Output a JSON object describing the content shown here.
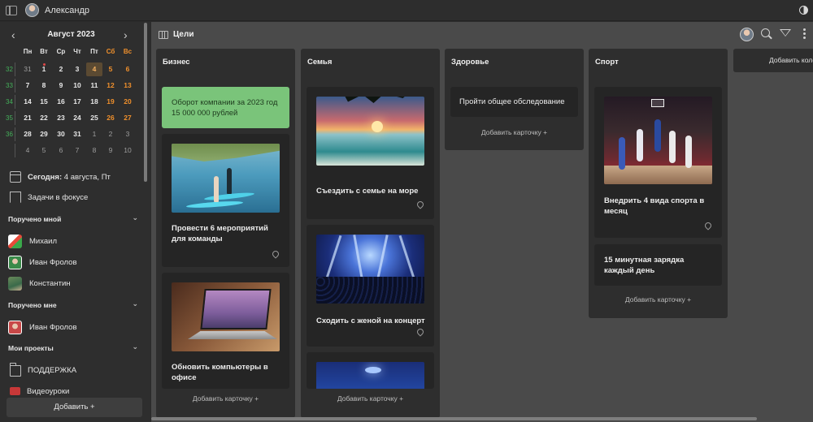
{
  "topbar": {
    "user_name": "Александр"
  },
  "calendar": {
    "month_label": "Август 2023",
    "weekdays": [
      "Пн",
      "Вт",
      "Ср",
      "Чт",
      "Пт",
      "Сб",
      "Вс"
    ],
    "weeks": [
      {
        "num": "32",
        "days": [
          "31",
          "1",
          "2",
          "3",
          "4",
          "5",
          "6"
        ]
      },
      {
        "num": "33",
        "days": [
          "7",
          "8",
          "9",
          "10",
          "11",
          "12",
          "13"
        ]
      },
      {
        "num": "34",
        "days": [
          "14",
          "15",
          "16",
          "17",
          "18",
          "19",
          "20"
        ]
      },
      {
        "num": "35",
        "days": [
          "21",
          "22",
          "23",
          "24",
          "25",
          "26",
          "27"
        ]
      },
      {
        "num": "36",
        "days": [
          "28",
          "29",
          "30",
          "31",
          "1",
          "2",
          "3"
        ]
      },
      {
        "num": "",
        "days": [
          "4",
          "5",
          "6",
          "7",
          "8",
          "9",
          "10"
        ]
      }
    ],
    "today_bold": "Сегодня:",
    "today_rest": " 4 августа, Пт"
  },
  "sidebar": {
    "focus_label": "Задачи в фокусе",
    "assigned_by_me": "Поручено мной",
    "people_by_me": [
      "Михаил",
      "Иван Фролов",
      "Константин"
    ],
    "assigned_to_me": "Поручено мне",
    "people_to_me": [
      "Иван Фролов"
    ],
    "my_projects": "Мои проекты",
    "project_support": "ПОДДЕРЖКА",
    "project_video": "Видеоуроки",
    "add_button": "Добавить  +"
  },
  "board": {
    "title": "Цели",
    "add_card": "Добавить карточку  +",
    "add_column": "Добавить колонку",
    "columns": [
      {
        "title": "Бизнес",
        "cards": [
          "Оборот компании за 2023 год 15 000 000 рублей",
          "Провести 6 мероприятий для команды",
          "Обновить компьютеры в офисе"
        ]
      },
      {
        "title": "Семья",
        "cards": [
          "Съездить с семье на море",
          "Сходить с женой на концерт"
        ]
      },
      {
        "title": "Здоровье",
        "cards": [
          "Пройти общее обследование"
        ]
      },
      {
        "title": "Спорт",
        "cards": [
          "Внедрить 4 вида спорта в месяц",
          "15 минутная зарядка каждый день"
        ]
      }
    ]
  },
  "colors": {
    "accent_green": "#7ac47a",
    "weekend_orange": "#f0902c",
    "week_green": "#44b05a"
  }
}
